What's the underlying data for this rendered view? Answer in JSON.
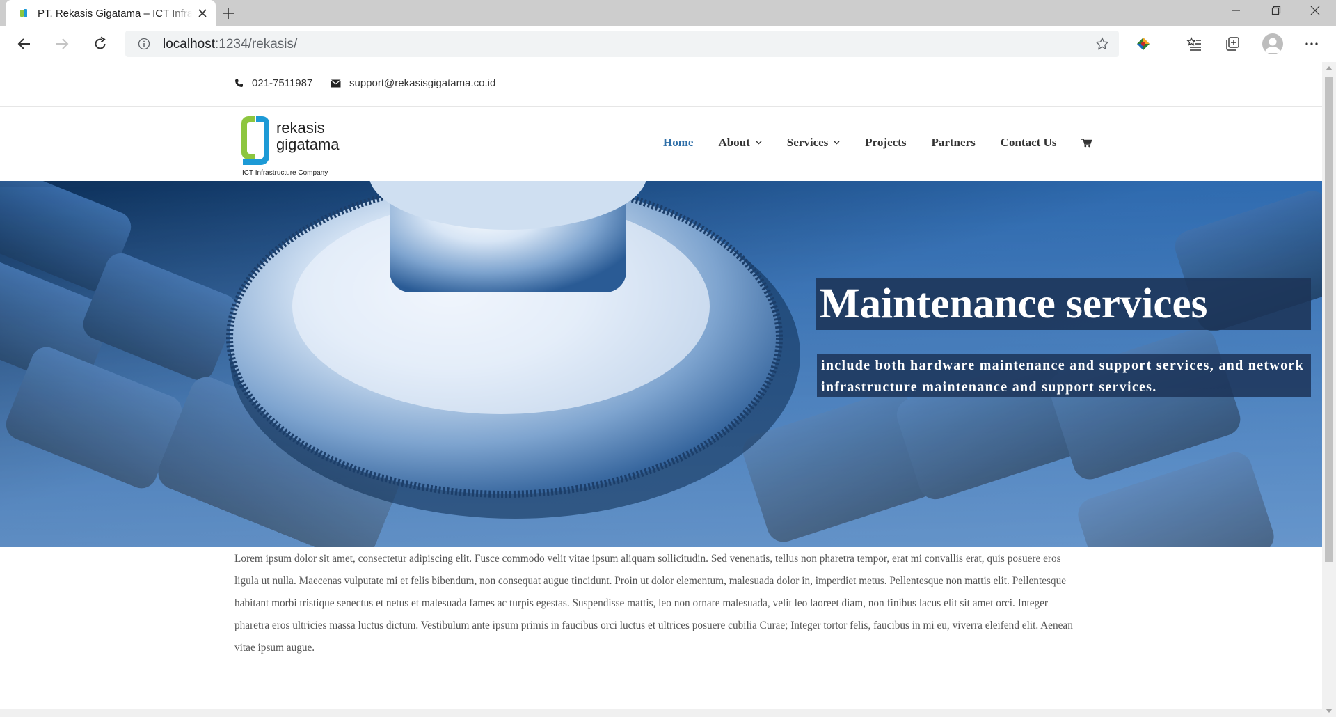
{
  "browser": {
    "tab_title": "PT. Rekasis Gigatama – ICT Infrastructure Company",
    "url_host": "localhost",
    "url_path": ":1234/rekasis/",
    "icons": [
      "back-arrow-icon",
      "forward-arrow-icon",
      "reload-icon",
      "info-icon",
      "star-icon",
      "extension-icon",
      "favorites-icon",
      "collections-icon",
      "profile-avatar",
      "more-menu-icon"
    ]
  },
  "topbar": {
    "phone": "021-7511987",
    "email": "support@rekasisgigatama.co.id"
  },
  "logo": {
    "line1": "rekasis",
    "line2": "gigatama",
    "tagline": "ICT Infrastructure Company",
    "colors": {
      "green": "#8dc63f",
      "blue": "#1d9ad6"
    }
  },
  "nav": {
    "items": [
      {
        "label": "Home",
        "active": true,
        "dropdown": false
      },
      {
        "label": "About",
        "active": false,
        "dropdown": true
      },
      {
        "label": "Services",
        "active": false,
        "dropdown": true
      },
      {
        "label": "Projects",
        "active": false,
        "dropdown": false
      },
      {
        "label": "Partners",
        "active": false,
        "dropdown": false
      },
      {
        "label": "Contact Us",
        "active": false,
        "dropdown": false
      }
    ],
    "cart_icon": "cart-icon",
    "active_color": "#2f6fa8"
  },
  "hero": {
    "title": "Maintenance services",
    "subtitle": "include both hardware maintenance and support services, and network infrastructure maintenance and support services."
  },
  "content": {
    "paragraph": "Lorem ipsum dolor sit amet, consectetur adipiscing elit. Fusce commodo velit vitae ipsum aliquam sollicitudin. Sed venenatis, tellus non pharetra tempor, erat mi convallis erat, quis posuere eros ligula ut nulla. Maecenas vulputate mi et felis bibendum, non consequat augue tincidunt. Proin ut dolor elementum, malesuada dolor in, imperdiet metus. Pellentesque non mattis elit. Pellentesque habitant morbi tristique senectus et netus et malesuada fames ac turpis egestas. Suspendisse mattis, leo non ornare malesuada, velit leo laoreet diam, non finibus lacus elit sit amet orci. Integer pharetra eros ultricies massa luctus dictum. Vestibulum ante ipsum primis in faucibus orci luctus et ultrices posuere cubilia Curae; Integer tortor felis, faucibus in mi eu, viverra eleifend elit. Aenean vitae ipsum augue."
  }
}
